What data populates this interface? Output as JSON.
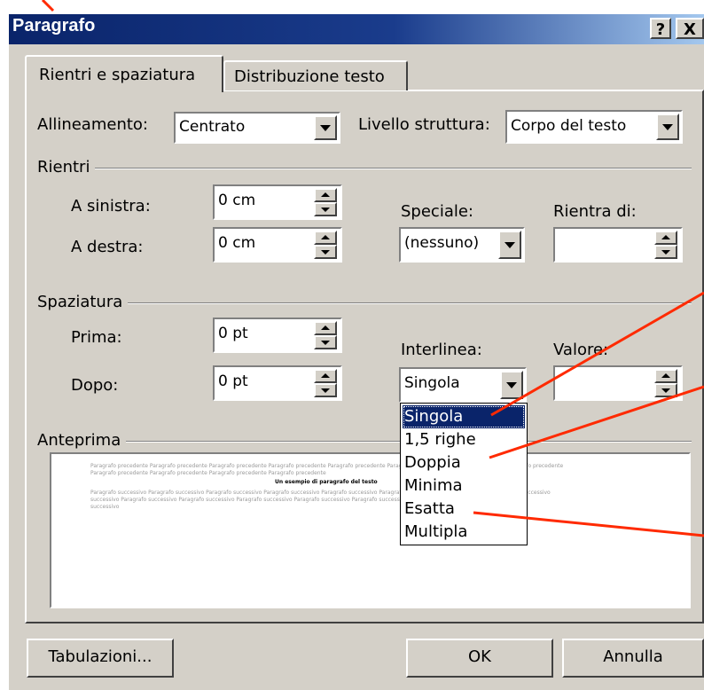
{
  "dialog": {
    "title": "Paragrafo",
    "help_label": "?",
    "close_label": "X"
  },
  "tabs": [
    {
      "label": "Rientri e spaziatura",
      "active": true
    },
    {
      "label": "Distribuzione testo",
      "active": false
    }
  ],
  "alignment": {
    "label": "Allineamento:",
    "value": "Centrato"
  },
  "outline_level": {
    "label": "Livello struttura:",
    "value": "Corpo del testo"
  },
  "indents": {
    "group_label": "Rientri",
    "left": {
      "label": "A sinistra:",
      "value": "0 cm"
    },
    "right": {
      "label": "A destra:",
      "value": "0 cm"
    },
    "special": {
      "label": "Speciale:",
      "value": "(nessuno)"
    },
    "by": {
      "label": "Rientra di:",
      "value": ""
    }
  },
  "spacing": {
    "group_label": "Spaziatura",
    "before": {
      "label": "Prima:",
      "value": "0 pt"
    },
    "after": {
      "label": "Dopo:",
      "value": "0 pt"
    },
    "line_spacing": {
      "label": "Interlinea:",
      "value": "Singola"
    },
    "at": {
      "label": "Valore:",
      "value": ""
    }
  },
  "line_spacing_options": [
    "Singola",
    "1,5 righe",
    "Doppia",
    "Minima",
    "Esatta",
    "Multipla"
  ],
  "preview": {
    "label": "Anteprima",
    "prev_line_1": "Paragrafo precedente Paragrafo precedente Paragrafo precedente Paragrafo precedente Paragrafo precedente Paragrafo precedente Paragrafo precedente Paragrafo precedente",
    "prev_line_2": "Paragrafo precedente Paragrafo precedente Paragrafo precedente Paragrafo precedente",
    "sample": "Un esempio di paragrafo del testo",
    "next_line_1": "Paragrafo successivo Paragrafo successivo Paragrafo successivo Paragrafo successivo Paragrafo successivo Paragrafo successivo Paragrafo successivo Paragrafo successivo",
    "next_line_2": "successivo Paragrafo successivo Paragrafo successivo Paragrafo successivo Paragrafo successivo Paragrafo successivo Paragrafo successivo Paragrafo successivo",
    "next_line_3": "successivo"
  },
  "buttons": {
    "tabs_label": "Tabulazioni...",
    "ok_label": "OK",
    "cancel_label": "Annulla"
  },
  "colors": {
    "title_bar": "#0a246a",
    "selection": "#0a246a",
    "annotation_arrow": "#ff2a00",
    "face": "#d4d0c8"
  }
}
